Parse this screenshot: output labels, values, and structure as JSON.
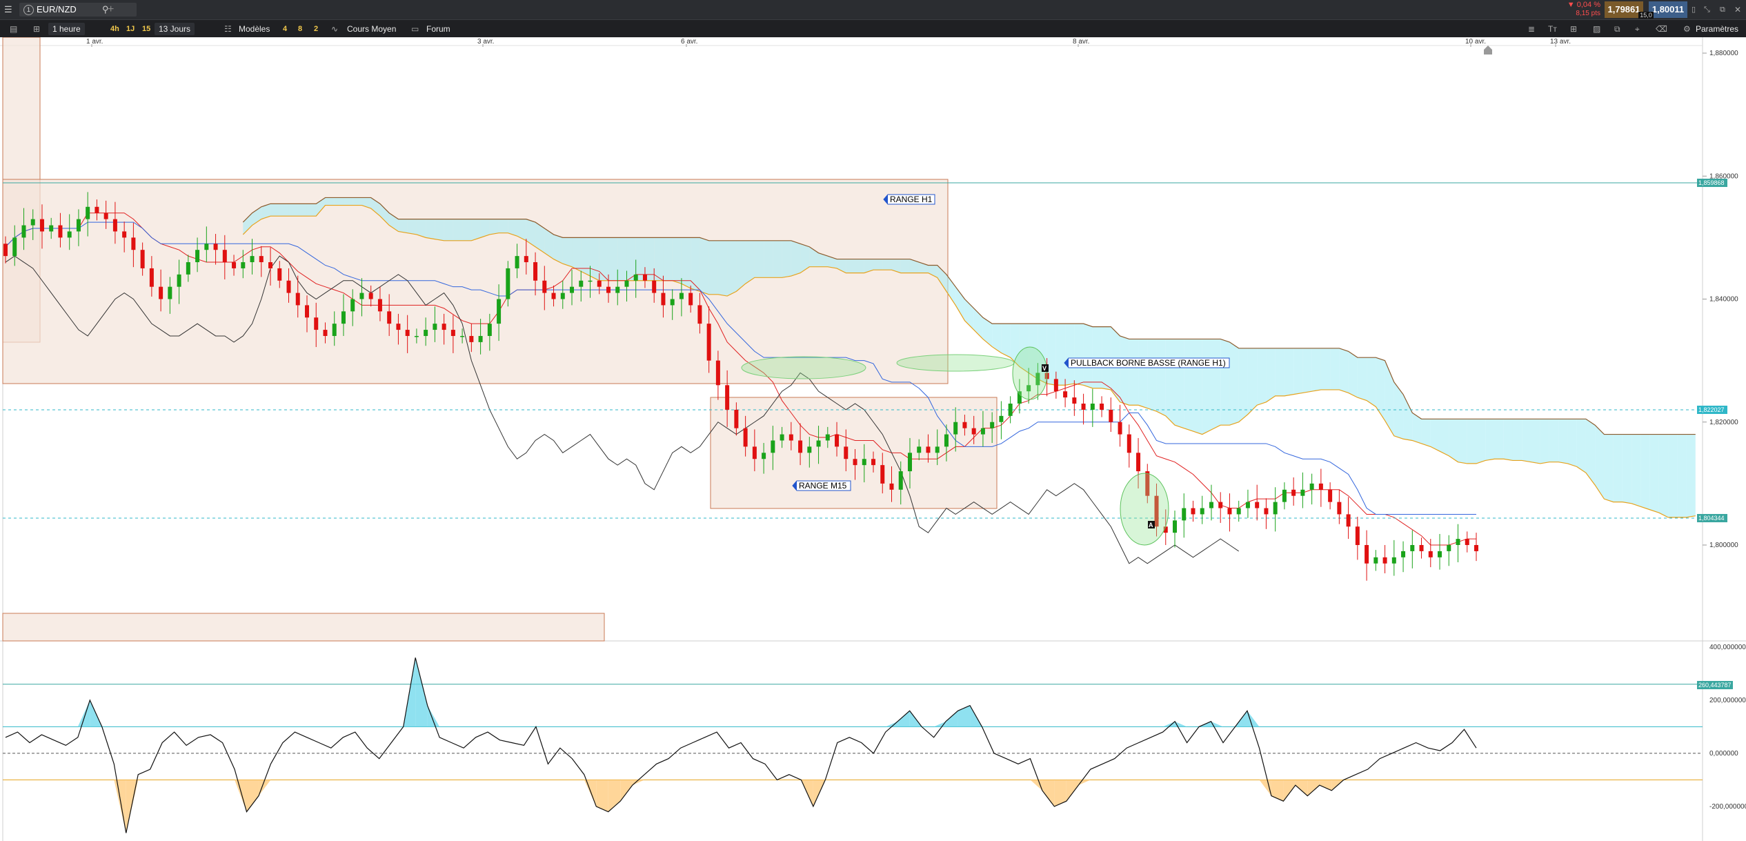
{
  "topbar": {
    "menu_icon": "hamburger-icon",
    "tab_number": "1",
    "symbol": "EUR/NZD",
    "search_icon": "search-icon",
    "add_tab_icon": "plus-icon",
    "change_percent": "▼ 0,04 %",
    "change_pips": "8,15 pts",
    "bid": "1,79861",
    "spread": "15,0",
    "ask": "1,80011",
    "sell_color": "#7a5a2a",
    "buy_color": "#3d5f8a"
  },
  "toolbar": {
    "timeframe": "1 heure",
    "quick_timeframes": [
      "4h",
      "1J",
      "15"
    ],
    "period": "13 Jours",
    "models_label": "Modèles",
    "model_counts": [
      "4",
      "8",
      "2"
    ],
    "indicator_label": "Cours Moyen",
    "forum_label": "Forum",
    "settings_label": "Paramètres"
  },
  "chart_data": [
    {
      "type": "candlestick",
      "symbol": "EUR/NZD",
      "timeframe": "1 heure",
      "x_ticks": [
        "1 avr.",
        "3 avr.",
        "6 avr.",
        "8 avr.",
        "10 avr.",
        "13 avr."
      ],
      "y_ticks": [
        "1,880000",
        "1,860000",
        "1,840000",
        "1,820000",
        "1,800000"
      ],
      "ylim": [
        1.785,
        1.881
      ],
      "price_tags": [
        "1,859868",
        "1,822027",
        "1,804344"
      ],
      "horizontal_levels": [
        1.859868,
        1.822027,
        1.804344
      ],
      "annotations": [
        "RANGE H1",
        "PULLBACK BORNE BASSE (RANGE H1)",
        "RANGE M15"
      ],
      "markers": [
        "V",
        "A"
      ],
      "close_series": [
        1.847,
        1.85,
        1.852,
        1.853,
        1.851,
        1.852,
        1.85,
        1.851,
        1.853,
        1.855,
        1.854,
        1.853,
        1.851,
        1.85,
        1.848,
        1.845,
        1.842,
        1.84,
        1.842,
        1.844,
        1.846,
        1.848,
        1.849,
        1.848,
        1.846,
        1.845,
        1.846,
        1.847,
        1.846,
        1.845,
        1.843,
        1.841,
        1.839,
        1.837,
        1.835,
        1.834,
        1.836,
        1.838,
        1.84,
        1.841,
        1.84,
        1.838,
        1.836,
        1.835,
        1.834,
        1.834,
        1.835,
        1.836,
        1.835,
        1.834,
        1.834,
        1.833,
        1.834,
        1.836,
        1.84,
        1.845,
        1.847,
        1.846,
        1.843,
        1.841,
        1.84,
        1.841,
        1.842,
        1.843,
        1.843,
        1.842,
        1.841,
        1.842,
        1.843,
        1.844,
        1.843,
        1.841,
        1.839,
        1.84,
        1.841,
        1.839,
        1.836,
        1.83,
        1.826,
        1.822,
        1.819,
        1.816,
        1.814,
        1.815,
        1.817,
        1.818,
        1.817,
        1.815,
        1.816,
        1.817,
        1.818,
        1.816,
        1.814,
        1.813,
        1.814,
        1.813,
        1.81,
        1.809,
        1.812,
        1.815,
        1.816,
        1.815,
        1.816,
        1.818,
        1.82,
        1.819,
        1.818,
        1.819,
        1.82,
        1.821,
        1.823,
        1.825,
        1.826,
        1.828,
        1.827,
        1.825,
        1.824,
        1.823,
        1.822,
        1.823,
        1.822,
        1.82,
        1.818,
        1.815,
        1.812,
        1.808,
        1.803,
        1.802,
        1.804,
        1.806,
        1.805,
        1.806,
        1.807,
        1.806,
        1.805,
        1.806,
        1.807,
        1.806,
        1.805,
        1.807,
        1.809,
        1.808,
        1.809,
        1.81,
        1.809,
        1.807,
        1.805,
        1.803,
        1.8,
        1.797,
        1.798,
        1.797,
        1.798,
        1.799,
        1.8,
        1.799,
        1.798,
        1.799,
        1.8,
        1.801,
        1.8,
        1.799
      ]
    },
    {
      "type": "line",
      "name": "CCI",
      "y_ticks": [
        "400,000000",
        "200,000000",
        "0,000000",
        "-200,000000"
      ],
      "price_tag": "260,443787",
      "ylim": [
        -330,
        410
      ],
      "levels": [
        260,
        100,
        0,
        -100
      ],
      "values": [
        60,
        80,
        40,
        70,
        50,
        30,
        60,
        200,
        100,
        -40,
        -300,
        -80,
        -60,
        40,
        80,
        30,
        60,
        70,
        40,
        -60,
        -220,
        -160,
        -40,
        40,
        80,
        60,
        40,
        20,
        60,
        80,
        20,
        -20,
        40,
        100,
        360,
        180,
        60,
        40,
        20,
        60,
        80,
        50,
        40,
        30,
        100,
        -40,
        20,
        -20,
        -80,
        -200,
        -220,
        -180,
        -120,
        -80,
        -40,
        -20,
        20,
        40,
        60,
        80,
        20,
        40,
        -20,
        -40,
        -100,
        -80,
        -100,
        -200,
        -100,
        40,
        60,
        40,
        0,
        80,
        120,
        160,
        100,
        60,
        120,
        160,
        180,
        100,
        0,
        -20,
        -40,
        -20,
        -140,
        -200,
        -180,
        -120,
        -60,
        -40,
        -20,
        20,
        40,
        60,
        80,
        120,
        40,
        100,
        120,
        40,
        100,
        160,
        20,
        -160,
        -180,
        -120,
        -160,
        -120,
        -140,
        -100,
        -80,
        -60,
        -20,
        0,
        20,
        40,
        20,
        10,
        40,
        90,
        20
      ]
    }
  ]
}
